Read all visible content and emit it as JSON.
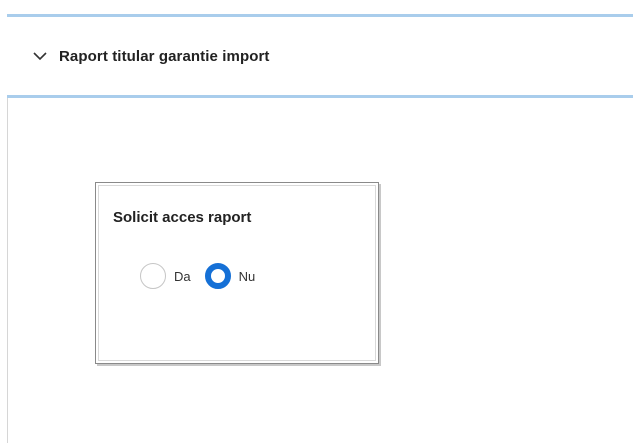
{
  "section": {
    "title": "Raport titular garantie import",
    "expanded": true,
    "chevron_icon": "chevron-down-icon"
  },
  "card": {
    "title": "Solicit acces raport",
    "options": [
      {
        "label": "Da",
        "selected": false
      },
      {
        "label": "Nu",
        "selected": true
      }
    ]
  },
  "colors": {
    "header_border": "#a9cdec",
    "radio_selected": "#1570d6",
    "radio_unselected": "#c6c6c6"
  }
}
